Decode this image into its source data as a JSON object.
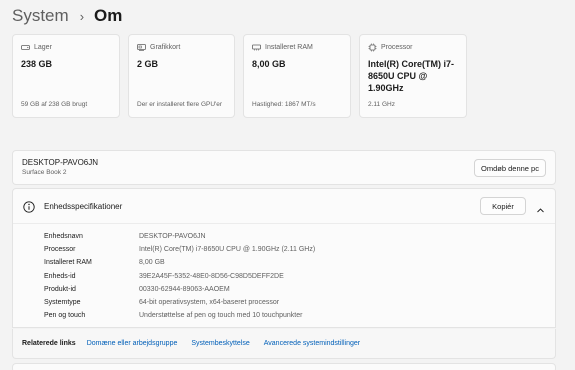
{
  "breadcrumb": {
    "root": "System",
    "separator": "›",
    "current": "Om"
  },
  "cards": [
    {
      "icon": "storage-icon",
      "label": "Lager",
      "value": "238 GB",
      "detail": "59 GB af 238 GB brugt"
    },
    {
      "icon": "graphics-card-icon",
      "label": "Grafikkort",
      "value": "2 GB",
      "detail": "Der er installeret flere GPU'er"
    },
    {
      "icon": "ram-icon",
      "label": "Installeret RAM",
      "value": "8,00 GB",
      "detail": "Hastighed: 1867 MT/s"
    },
    {
      "icon": "processor-icon",
      "label": "Processor",
      "value": "Intel(R) Core(TM) i7-8650U CPU @ 1.90GHz",
      "detail": "2.11 GHz"
    }
  ],
  "device": {
    "name": "DESKTOP-PAVO6JN",
    "model": "Surface Book 2",
    "rename_label": "Omdøb denne pc"
  },
  "specs": {
    "title": "Enhedsspecifikationer",
    "copy_label": "Kopiér",
    "rows": [
      {
        "key": "Enhedsnavn",
        "value": "DESKTOP-PAVO6JN"
      },
      {
        "key": "Processor",
        "value": "Intel(R) Core(TM) i7-8650U CPU @ 1.90GHz (2.11 GHz)"
      },
      {
        "key": "Installeret RAM",
        "value": "8,00 GB"
      },
      {
        "key": "Enheds-id",
        "value": "39E2A45F-5352-48E0-8D56-C98D5DEFF2DE"
      },
      {
        "key": "Produkt-id",
        "value": "00330-62944-89063-AAOEM"
      },
      {
        "key": "Systemtype",
        "value": "64-bit operativsystem, x64-baseret processor"
      },
      {
        "key": "Pen og touch",
        "value": "Understøttelse af pen og touch med 10 touchpunkter"
      }
    ]
  },
  "related": {
    "label": "Relaterede links",
    "links": [
      "Domæne eller arbejdsgruppe",
      "Systembeskyttelse",
      "Avancerede systemindstillinger"
    ]
  },
  "colors": {
    "background": "#f3f3f3",
    "card": "#fbfbfb",
    "link": "#005fb8",
    "text": "#1b1b1b",
    "secondary_text": "#5f5f5f"
  }
}
